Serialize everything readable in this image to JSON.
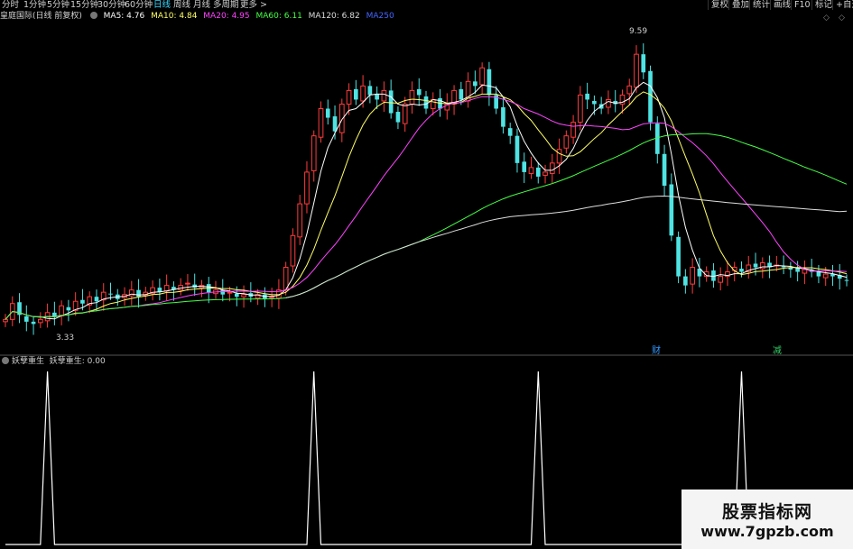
{
  "toolbar": {
    "periods": [
      "分时",
      "1分钟",
      "5分钟",
      "15分钟",
      "30分钟",
      "60分钟",
      "日线",
      "周线",
      "月线",
      "多周期",
      "更多 >"
    ],
    "active_period": "日线",
    "tools": [
      "复权",
      "叠加",
      "统计",
      "画线",
      "F10",
      "标记",
      "+自选"
    ]
  },
  "main_panel": {
    "stock_label": "皇庭国际(日线 前复权)",
    "ma_labels": [
      {
        "text": "MA5: 4.76",
        "color": "#ffffff"
      },
      {
        "text": "MA10: 4.84",
        "color": "#ffff66"
      },
      {
        "text": "MA20: 4.95",
        "color": "#ff44ff"
      },
      {
        "text": "MA60: 6.11",
        "color": "#44ff44"
      },
      {
        "text": "MA120: 6.82",
        "color": "#dddddd"
      },
      {
        "text": "MA250",
        "color": "#4466ff"
      }
    ],
    "high_label": "9.59",
    "low_label": "3.33",
    "badges": [
      {
        "text": "财",
        "color": "#3399ff"
      },
      {
        "text": "减",
        "color": "#33cc66"
      }
    ]
  },
  "sub_panel": {
    "indicator_name": "妖孽重生",
    "value_text": "妖孽重生: 0.00"
  },
  "watermark": {
    "line1": "股票指标网",
    "line2": "www.7gpzb.com"
  },
  "chart_data": [
    {
      "type": "candlestick",
      "title": "皇庭国际(日线 前复权)",
      "ylim": [
        3.0,
        10.0
      ],
      "price_range_labels": {
        "high": 9.59,
        "low": 3.33
      },
      "moving_averages": {
        "MA5": 4.76,
        "MA10": 4.84,
        "MA20": 4.95,
        "MA60": 6.11,
        "MA120": 6.82
      },
      "closes": [
        3.55,
        3.9,
        3.65,
        3.5,
        3.45,
        3.55,
        3.7,
        3.6,
        3.85,
        3.75,
        3.95,
        3.9,
        4.05,
        3.95,
        4.15,
        4.1,
        4.0,
        4.1,
        4.2,
        4.05,
        4.15,
        4.25,
        4.15,
        4.3,
        4.2,
        4.3,
        4.35,
        4.25,
        4.3,
        4.15,
        4.2,
        4.1,
        4.15,
        4.05,
        4.1,
        4.05,
        4.1,
        4.0,
        4.05,
        4.2,
        4.7,
        5.4,
        6.1,
        6.8,
        7.6,
        8.2,
        8.0,
        7.7,
        8.3,
        8.6,
        8.4,
        8.7,
        8.5,
        8.4,
        8.6,
        8.1,
        7.9,
        8.3,
        8.6,
        8.5,
        8.2,
        8.4,
        8.2,
        8.3,
        8.6,
        8.4,
        8.8,
        8.7,
        9.1,
        8.5,
        8.2,
        7.8,
        7.6,
        7.0,
        6.8,
        6.9,
        6.7,
        6.8,
        7.0,
        7.3,
        7.6,
        7.9,
        8.5,
        8.4,
        8.3,
        8.2,
        8.4,
        8.3,
        8.5,
        8.7,
        9.4,
        9.0,
        7.9,
        7.2,
        6.5,
        5.4,
        4.5,
        4.3,
        4.7,
        4.5,
        4.6,
        4.4,
        4.5,
        4.6,
        4.7,
        4.6,
        4.75,
        4.7,
        4.8,
        4.7,
        4.75,
        4.7,
        4.65,
        4.6,
        4.65,
        4.6,
        4.5,
        4.55,
        4.5,
        4.45,
        4.4
      ],
      "ma_series": [
        {
          "name": "MA5",
          "color": "#ffffff",
          "period": 5
        },
        {
          "name": "MA10",
          "color": "#ffff66",
          "period": 10
        },
        {
          "name": "MA20",
          "color": "#ff44ff",
          "period": 20
        },
        {
          "name": "MA60",
          "color": "#44ff44",
          "period": 60
        },
        {
          "name": "MA120",
          "color": "#dddddd",
          "period": 120
        }
      ]
    },
    {
      "type": "line",
      "title": "妖孽重生",
      "ylim": [
        0,
        1
      ],
      "spikes_at_bar": [
        6,
        44,
        76,
        105
      ],
      "value": 0.0
    }
  ]
}
